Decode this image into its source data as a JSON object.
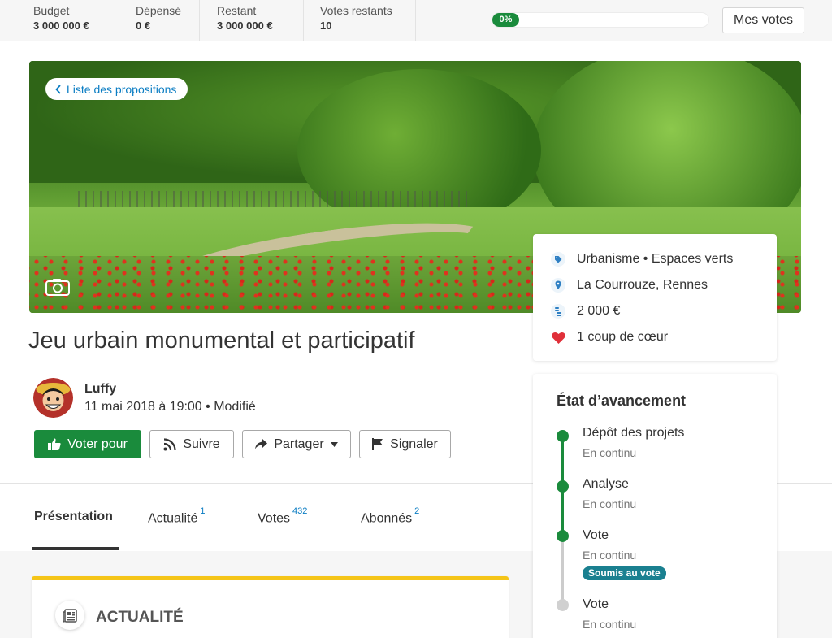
{
  "budget": {
    "cells": [
      {
        "label": "Budget",
        "value": "3 000 000 €"
      },
      {
        "label": "Dépensé",
        "value": "0 €"
      },
      {
        "label": "Restant",
        "value": "3 000 000 €"
      },
      {
        "label": "Votes restants",
        "value": "10"
      }
    ],
    "progress_label": "0%",
    "progress_value": 0,
    "my_votes_label": "Mes votes"
  },
  "hero": {
    "back_label": "Liste des propositions"
  },
  "proposal": {
    "title": "Jeu urbain monumental et participatif",
    "author": "Luffy",
    "meta": "11 mai 2018 à 19:00 • Modifié"
  },
  "actions": {
    "vote": "Voter pour",
    "follow": "Suivre",
    "share": "Partager",
    "report": "Signaler"
  },
  "tabs": [
    {
      "label": "Présentation",
      "count": ""
    },
    {
      "label": "Actualité",
      "count": "1"
    },
    {
      "label": "Votes",
      "count": "432"
    },
    {
      "label": "Abonnés",
      "count": "2"
    }
  ],
  "news": {
    "title": "ACTUALITÉ"
  },
  "info": {
    "category": "Urbanisme • Espaces verts",
    "location": "La Courrouze, Rennes",
    "cost": "2 000 €",
    "favorites": "1 coup de cœur"
  },
  "steps": {
    "title": "État d’avancement",
    "items": [
      {
        "name": "Dépôt des projets",
        "sub": "En continu",
        "badge": "",
        "state": "done"
      },
      {
        "name": "Analyse",
        "sub": "En continu",
        "badge": "",
        "state": "done"
      },
      {
        "name": "Vote",
        "sub": "En continu",
        "badge": "Soumis au vote",
        "state": "current"
      },
      {
        "name": "Vote",
        "sub": "En continu",
        "badge": "",
        "state": "todo"
      }
    ]
  },
  "colors": {
    "accent": "#1a8b3c",
    "link": "#0b7dc3",
    "badge": "#1a8090",
    "heart": "#e0303a"
  }
}
